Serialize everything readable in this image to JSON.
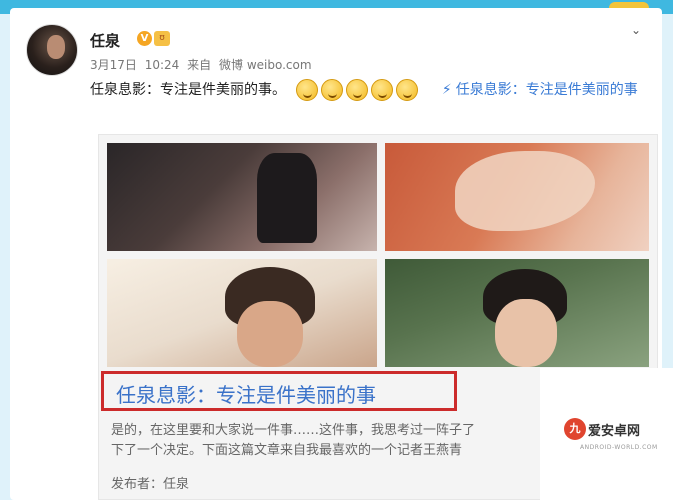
{
  "user": {
    "name": "任泉",
    "verified_badge": "V",
    "member_badge": "ʊ"
  },
  "meta": {
    "date": "3月17日",
    "time": "10:24",
    "source_prefix": "来自",
    "source": "微博 weibo.com"
  },
  "post": {
    "text": "任泉息影：专注是件美丽的事。",
    "emoji_count": 5,
    "emoji_name": "thinking-face",
    "link_icon": "⚡",
    "link_text": "任泉息影：专注是件美丽的事"
  },
  "article": {
    "title": "任泉息影：专注是件美丽的事",
    "excerpt_line1": "是的，在这里要和大家说一件事……这件事，我思考过一阵子了",
    "excerpt_line2": "下了一个决定。下面这篇文章来自我最喜欢的一个记者王燕青",
    "publisher": "发布者：任泉"
  },
  "watermark": {
    "logo_char": "九",
    "text": "爱安卓网",
    "sub": "ANDROID-WORLD.COM"
  },
  "icons": {
    "chevron": "⌄"
  },
  "colors": {
    "link": "#3a7bd5",
    "title_border": "#cc2b2b",
    "badge": "#f5a623"
  }
}
